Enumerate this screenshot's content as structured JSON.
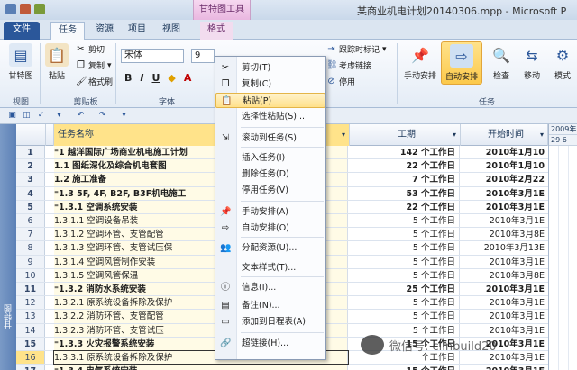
{
  "titlebar": {
    "context_tab_title": "甘特图工具",
    "window_title": "某商业机电计划20140306.mpp - Microsoft P"
  },
  "tabs": [
    {
      "label": "文件"
    },
    {
      "label": "任务"
    },
    {
      "label": "资源"
    },
    {
      "label": "项目"
    },
    {
      "label": "视图"
    },
    {
      "label": "格式"
    }
  ],
  "ribbon": {
    "view_group": {
      "button": "甘特图",
      "label": "视图"
    },
    "clipboard_group": {
      "paste": "粘贴",
      "cut": "剪切",
      "copy": "复制",
      "format_painter": "格式刷",
      "label": "剪贴板"
    },
    "font_group": {
      "font_name": "宋体",
      "font_size": "9",
      "bold": "B",
      "italic": "I",
      "underline": "U",
      "label": "字体"
    },
    "schedule_group": {
      "track_mark": "跟踪时标记",
      "respect_links": "考虑链接",
      "deactivate": "停用"
    },
    "tasks_group": {
      "manual": "手动安排",
      "auto": "自动安排",
      "inspect": "检查",
      "move": "移动",
      "mode": "模式",
      "label": "任务"
    }
  },
  "grid": {
    "headers": {
      "name": "任务名称",
      "duration": "工期",
      "start": "开始时间"
    },
    "rows": [
      {
        "num": "1",
        "name": "⁼1 越洋国际广场商业机电施工计划",
        "duration": "142 个工作日",
        "start": "2010年1月10",
        "summary": true
      },
      {
        "num": "2",
        "name": "   1.1 图纸深化及综合机电套图",
        "duration": "22 个工作日",
        "start": "2010年1月10",
        "summary": true
      },
      {
        "num": "3",
        "name": "   1.2 施工准备",
        "duration": "7 个工作日",
        "start": "2010年2月22",
        "summary": true
      },
      {
        "num": "4",
        "name": "⁼1.3 5F, 4F, B2F, B3F机电施工",
        "duration": "53 个工作日",
        "start": "2010年3月1E",
        "summary": true
      },
      {
        "num": "5",
        "name": "   ⁼1.3.1 空调系统安装",
        "duration": "22 个工作日",
        "start": "2010年3月1E",
        "summary": true
      },
      {
        "num": "6",
        "name": "         1.3.1.1 空调设备吊装",
        "duration": "5 个工作日",
        "start": "2010年3月1E",
        "summary": false
      },
      {
        "num": "7",
        "name": "         1.3.1.2 空调环管、支管配管",
        "duration": "5 个工作日",
        "start": "2010年3月8E",
        "summary": false
      },
      {
        "num": "8",
        "name": "         1.3.1.3 空调环管、支管试压保",
        "duration": "5 个工作日",
        "start": "2010年3月13E",
        "summary": false
      },
      {
        "num": "9",
        "name": "         1.3.1.4 空调风管制作安装",
        "duration": "5 个工作日",
        "start": "2010年3月1E",
        "summary": false
      },
      {
        "num": "10",
        "name": "         1.3.1.5 空调风管保温",
        "duration": "5 个工作日",
        "start": "2010年3月8E",
        "summary": false
      },
      {
        "num": "11",
        "name": "   ⁼1.3.2 消防水系统安装",
        "duration": "25 个工作日",
        "start": "2010年3月1E",
        "summary": true
      },
      {
        "num": "12",
        "name": "         1.3.2.1 原系统设备拆除及保护",
        "duration": "5 个工作日",
        "start": "2010年3月1E",
        "summary": false
      },
      {
        "num": "13",
        "name": "         1.3.2.2 消防环管、支管配管",
        "duration": "5 个工作日",
        "start": "2010年3月1E",
        "summary": false
      },
      {
        "num": "14",
        "name": "         1.3.2.3 消防环管、支管试压",
        "duration": "5 个工作日",
        "start": "2010年3月1E",
        "summary": false
      },
      {
        "num": "15",
        "name": "   ⁼1.3.3 火灾报警系统安装",
        "duration": "15 个工作日",
        "start": "2010年3月1E",
        "summary": true
      },
      {
        "num": "16",
        "name": "         1.3.3.1 原系统设备拆除及保护",
        "duration": "个工作日",
        "start": "2010年3月1E",
        "summary": false
      },
      {
        "num": "17",
        "name": "   ⁼1.3.4 电气系统安装",
        "duration": "15 个工作日",
        "start": "2010年3月1E",
        "summary": true
      }
    ]
  },
  "gantt": {
    "year": "2009年",
    "days": "29 6"
  },
  "left_bar_label": "甘特图",
  "context_menu": {
    "items": [
      {
        "label": "剪切(T)",
        "icon": "scissors-icon"
      },
      {
        "label": "复制(C)",
        "icon": "copy-icon"
      },
      {
        "label": "粘贴(P)",
        "icon": "paste-icon",
        "hover": true
      },
      {
        "label": "选择性粘贴(S)...",
        "icon": ""
      },
      {
        "label": "滚动到任务(S)",
        "icon": "scroll-icon"
      },
      {
        "label": "插入任务(I)",
        "icon": ""
      },
      {
        "label": "删除任务(D)",
        "icon": ""
      },
      {
        "label": "停用任务(V)",
        "icon": ""
      },
      {
        "label": "手动安排(A)",
        "icon": "pin-icon"
      },
      {
        "label": "自动安排(O)",
        "icon": "auto-schedule-icon"
      },
      {
        "label": "分配资源(U)...",
        "icon": "assign-resource-icon"
      },
      {
        "label": "文本样式(T)...",
        "icon": ""
      },
      {
        "label": "信息(I)...",
        "icon": "info-icon"
      },
      {
        "label": "备注(N)...",
        "icon": "note-icon"
      },
      {
        "label": "添加到日程表(A)",
        "icon": "timeline-icon"
      },
      {
        "label": "超链接(H)...",
        "icon": "hyperlink-icon"
      }
    ]
  },
  "watermark": {
    "text": "微信号: clinbuild20"
  },
  "colors": {
    "accent": "#2b579a",
    "highlight": "#ffe38a",
    "context_tab": "#e9b7e0"
  }
}
